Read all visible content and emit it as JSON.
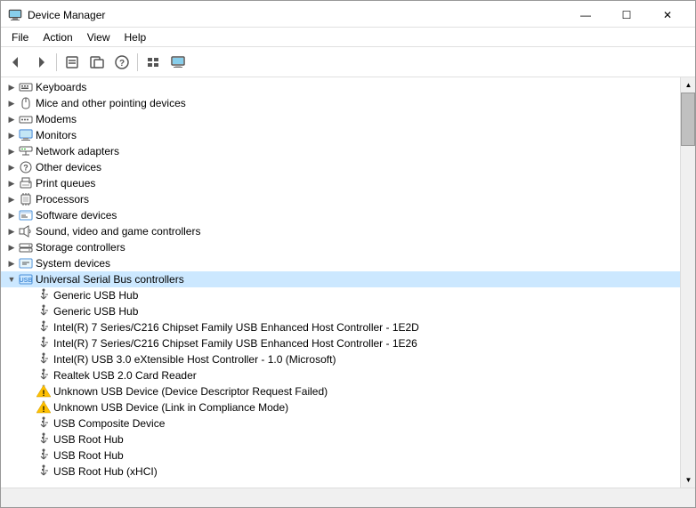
{
  "window": {
    "title": "Device Manager",
    "icon": "computer-icon"
  },
  "titlebar": {
    "minimize": "—",
    "maximize": "☐",
    "close": "✕"
  },
  "menu": {
    "items": [
      "File",
      "Action",
      "View",
      "Help"
    ]
  },
  "toolbar": {
    "buttons": [
      "←",
      "→",
      "☰",
      "☰",
      "?",
      "☰",
      "🖥"
    ]
  },
  "tree": {
    "items": [
      {
        "level": 1,
        "expand": "▶",
        "icon": "keyboard",
        "label": "Keyboards",
        "selected": false
      },
      {
        "level": 1,
        "expand": "▶",
        "icon": "mouse",
        "label": "Mice and other pointing devices",
        "selected": false
      },
      {
        "level": 1,
        "expand": "▶",
        "icon": "modem",
        "label": "Modems",
        "selected": false
      },
      {
        "level": 1,
        "expand": "▶",
        "icon": "monitor",
        "label": "Monitors",
        "selected": false
      },
      {
        "level": 1,
        "expand": "▶",
        "icon": "network",
        "label": "Network adapters",
        "selected": false
      },
      {
        "level": 1,
        "expand": "▶",
        "icon": "other",
        "label": "Other devices",
        "selected": false
      },
      {
        "level": 1,
        "expand": "▶",
        "icon": "print",
        "label": "Print queues",
        "selected": false
      },
      {
        "level": 1,
        "expand": "▶",
        "icon": "cpu",
        "label": "Processors",
        "selected": false
      },
      {
        "level": 1,
        "expand": "▶",
        "icon": "software",
        "label": "Software devices",
        "selected": false
      },
      {
        "level": 1,
        "expand": "▶",
        "icon": "sound",
        "label": "Sound, video and game controllers",
        "selected": false
      },
      {
        "level": 1,
        "expand": "▶",
        "icon": "storage",
        "label": "Storage controllers",
        "selected": false
      },
      {
        "level": 1,
        "expand": "▶",
        "icon": "system",
        "label": "System devices",
        "selected": false
      },
      {
        "level": 1,
        "expand": "▼",
        "icon": "usb",
        "label": "Universal Serial Bus controllers",
        "selected": true
      },
      {
        "level": 2,
        "expand": "",
        "icon": "usb-dev",
        "label": "Generic USB Hub",
        "selected": false
      },
      {
        "level": 2,
        "expand": "",
        "icon": "usb-dev",
        "label": "Generic USB Hub",
        "selected": false
      },
      {
        "level": 2,
        "expand": "",
        "icon": "usb-dev",
        "label": "Intel(R) 7 Series/C216 Chipset Family USB Enhanced Host Controller - 1E2D",
        "selected": false
      },
      {
        "level": 2,
        "expand": "",
        "icon": "usb-dev",
        "label": "Intel(R) 7 Series/C216 Chipset Family USB Enhanced Host Controller - 1E26",
        "selected": false
      },
      {
        "level": 2,
        "expand": "",
        "icon": "usb-dev",
        "label": "Intel(R) USB 3.0 eXtensible Host Controller - 1.0 (Microsoft)",
        "selected": false
      },
      {
        "level": 2,
        "expand": "",
        "icon": "usb-dev",
        "label": "Realtek USB 2.0 Card Reader",
        "selected": false
      },
      {
        "level": 2,
        "expand": "",
        "icon": "warn-dev",
        "label": "Unknown USB Device (Device Descriptor Request Failed)",
        "selected": false
      },
      {
        "level": 2,
        "expand": "",
        "icon": "warn-dev",
        "label": "Unknown USB Device (Link in Compliance Mode)",
        "selected": false
      },
      {
        "level": 2,
        "expand": "",
        "icon": "usb-dev",
        "label": "USB Composite Device",
        "selected": false
      },
      {
        "level": 2,
        "expand": "",
        "icon": "usb-dev",
        "label": "USB Root Hub",
        "selected": false
      },
      {
        "level": 2,
        "expand": "",
        "icon": "usb-dev",
        "label": "USB Root Hub",
        "selected": false
      },
      {
        "level": 2,
        "expand": "",
        "icon": "usb-dev",
        "label": "USB Root Hub (xHCI)",
        "selected": false
      }
    ]
  },
  "statusbar": {
    "text": ""
  }
}
